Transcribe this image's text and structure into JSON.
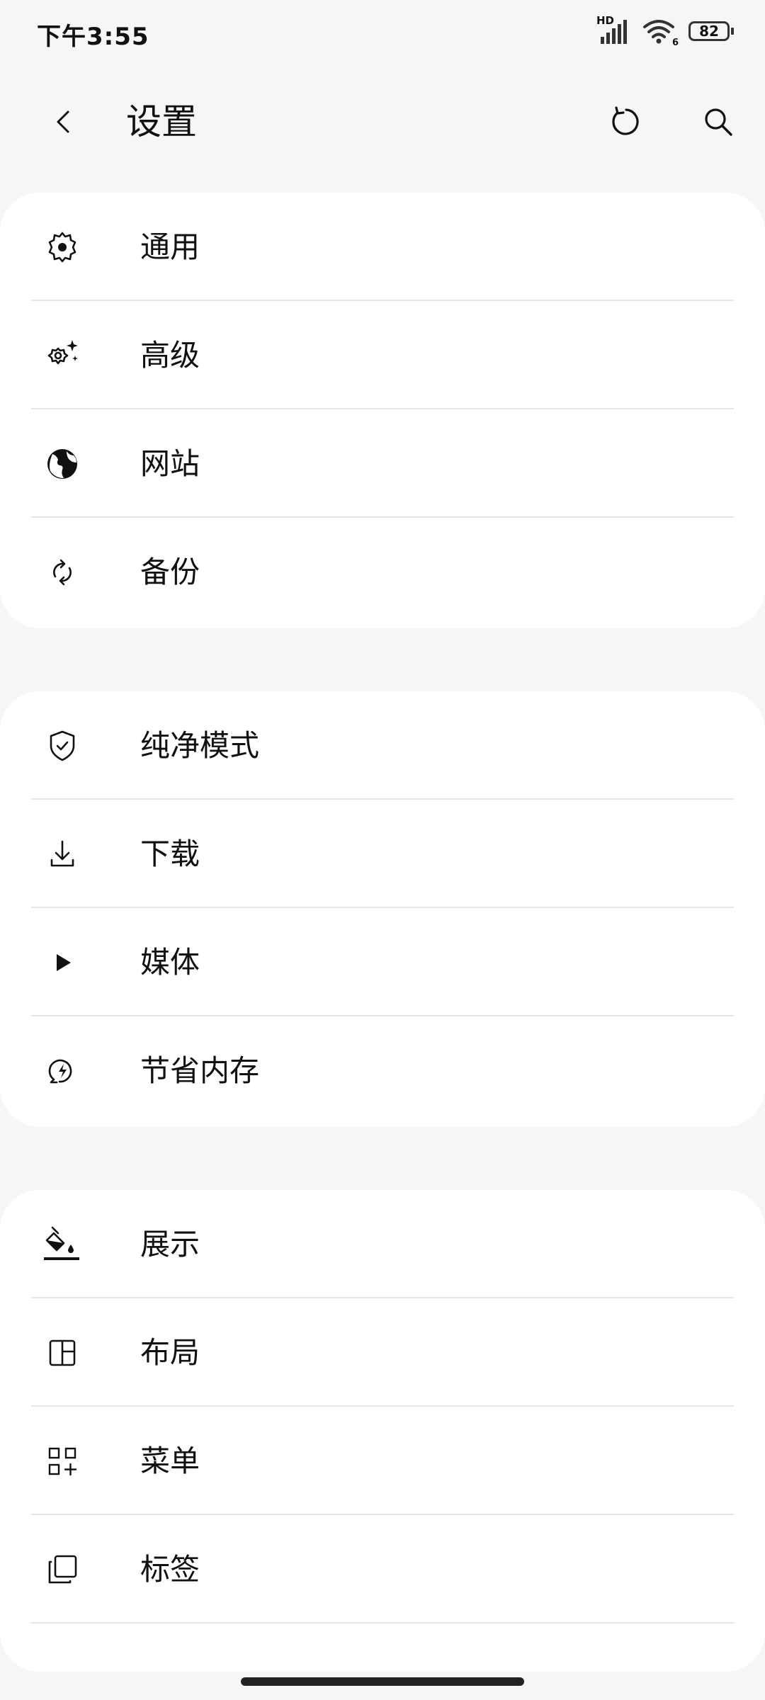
{
  "status_bar": {
    "time": "下午3:55",
    "network_label": "HD",
    "wifi_label": "6",
    "battery": "82"
  },
  "header": {
    "title": "设置",
    "back_icon": "chevron-left-icon",
    "reset_icon": "reset-icon",
    "search_icon": "search-icon"
  },
  "groups": [
    {
      "items": [
        {
          "label": "通用",
          "icon": "gear-icon"
        },
        {
          "label": "高级",
          "icon": "gear-sparkle-icon"
        },
        {
          "label": "网站",
          "icon": "globe-icon"
        },
        {
          "label": "备份",
          "icon": "sync-icon"
        }
      ]
    },
    {
      "items": [
        {
          "label": "纯净模式",
          "icon": "shield-check-icon"
        },
        {
          "label": "下载",
          "icon": "download-icon"
        },
        {
          "label": "媒体",
          "icon": "play-icon"
        },
        {
          "label": "节省内存",
          "icon": "memory-saver-icon"
        }
      ]
    },
    {
      "items": [
        {
          "label": "展示",
          "icon": "paint-bucket-icon"
        },
        {
          "label": "布局",
          "icon": "layout-icon"
        },
        {
          "label": "菜单",
          "icon": "grid-add-icon"
        },
        {
          "label": "标签",
          "icon": "tabs-icon"
        }
      ]
    }
  ]
}
